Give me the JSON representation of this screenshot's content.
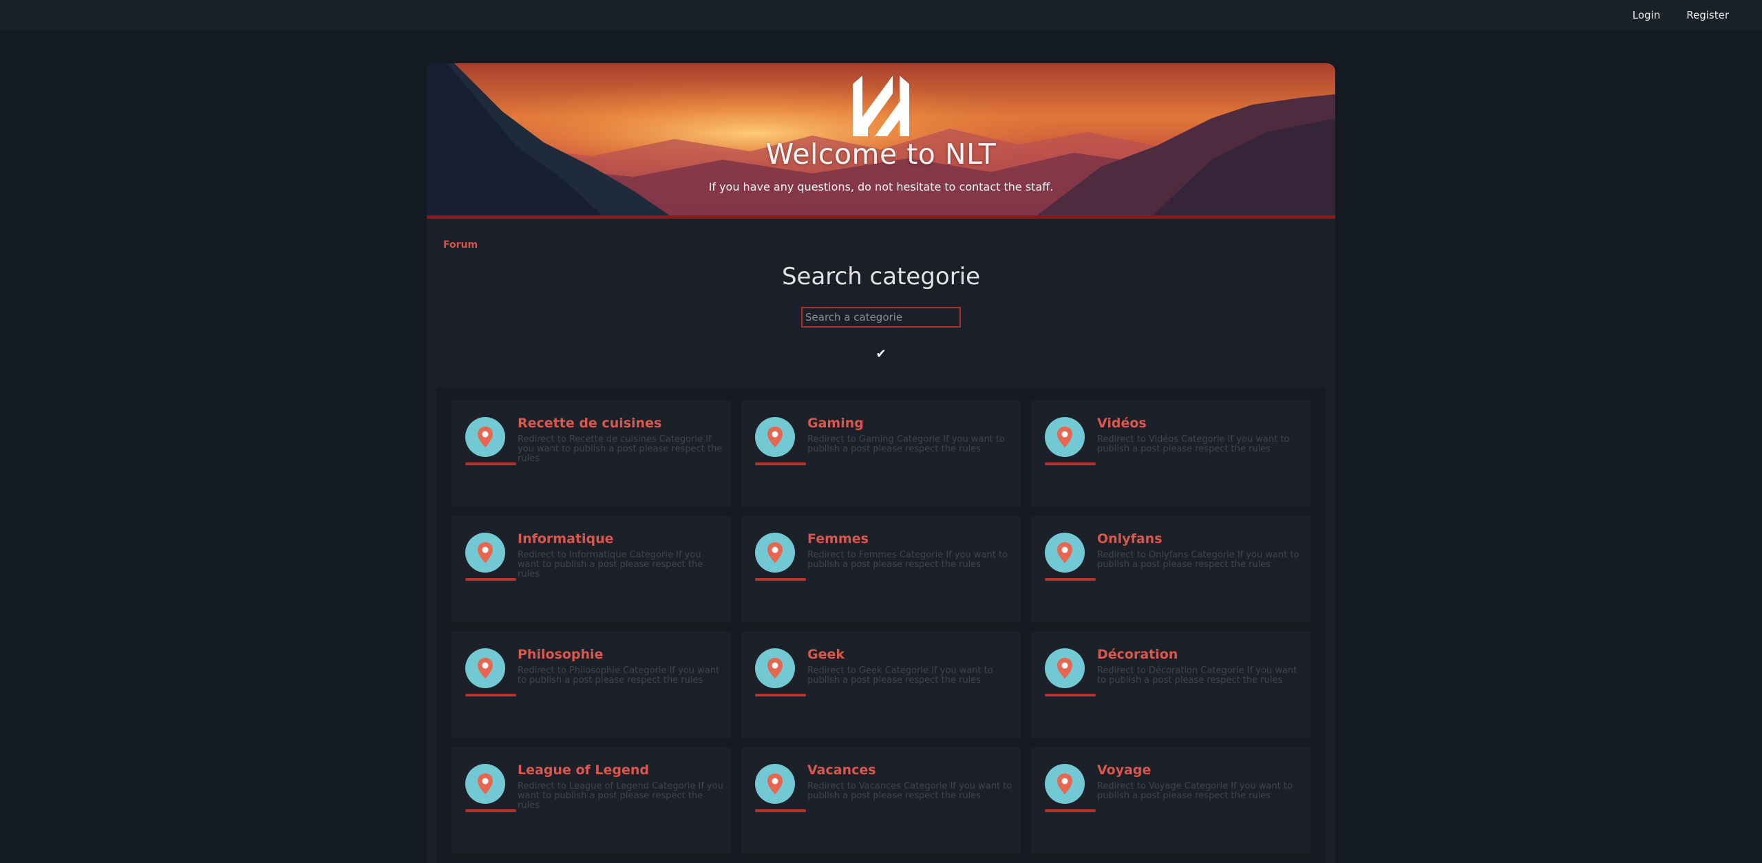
{
  "nav": {
    "login": "Login",
    "register": "Register"
  },
  "hero": {
    "title": "Welcome to NLT",
    "subtitle": "If you have any questions, do not hesitate to contact the staff."
  },
  "breadcrumb": "Forum",
  "search": {
    "title": "Search categorie",
    "placeholder": "Search a categorie",
    "submit": "✔"
  },
  "colors": {
    "accent": "#d9574c",
    "icon_bg": "#72c9d4",
    "background": "#141a21"
  },
  "categories": [
    {
      "name": "Recette de cuisines",
      "desc": "Redirect to Recette de cuisines Categorie If you want to publish a post please respect the rules",
      "icon": "location-pin-icon"
    },
    {
      "name": "Gaming",
      "desc": "Redirect to Gaming Categorie If you want to publish a post please respect the rules",
      "icon": "location-pin-icon"
    },
    {
      "name": "Vidéos",
      "desc": "Redirect to Vidéos Categorie If you want to publish a post please respect the rules",
      "icon": "location-pin-icon"
    },
    {
      "name": "Informatique",
      "desc": "Redirect to Informatique Categorie If you want to publish a post please respect the rules",
      "icon": "location-pin-icon"
    },
    {
      "name": "Femmes",
      "desc": "Redirect to Femmes Categorie If you want to publish a post please respect the rules",
      "icon": "location-pin-icon"
    },
    {
      "name": "Onlyfans",
      "desc": "Redirect to Onlyfans Categorie If you want to publish a post please respect the rules",
      "icon": "location-pin-icon"
    },
    {
      "name": "Philosophie",
      "desc": "Redirect to Philosophie Categorie If you want to publish a post please respect the rules",
      "icon": "location-pin-icon"
    },
    {
      "name": "Geek",
      "desc": "Redirect to Geek Categorie If you want to publish a post please respect the rules",
      "icon": "location-pin-icon"
    },
    {
      "name": "Décoration",
      "desc": "Redirect to Décoration Categorie If you want to publish a post please respect the rules",
      "icon": "location-pin-icon"
    },
    {
      "name": "League of Legend",
      "desc": "Redirect to League of Legend Categorie If you want to publish a post please respect the rules",
      "icon": "location-pin-icon"
    },
    {
      "name": "Vacances",
      "desc": "Redirect to Vacances Categorie If you want to publish a post please respect the rules",
      "icon": "location-pin-icon"
    },
    {
      "name": "Voyage",
      "desc": "Redirect to Voyage Categorie If you want to publish a post please respect the rules",
      "icon": "location-pin-icon"
    }
  ]
}
